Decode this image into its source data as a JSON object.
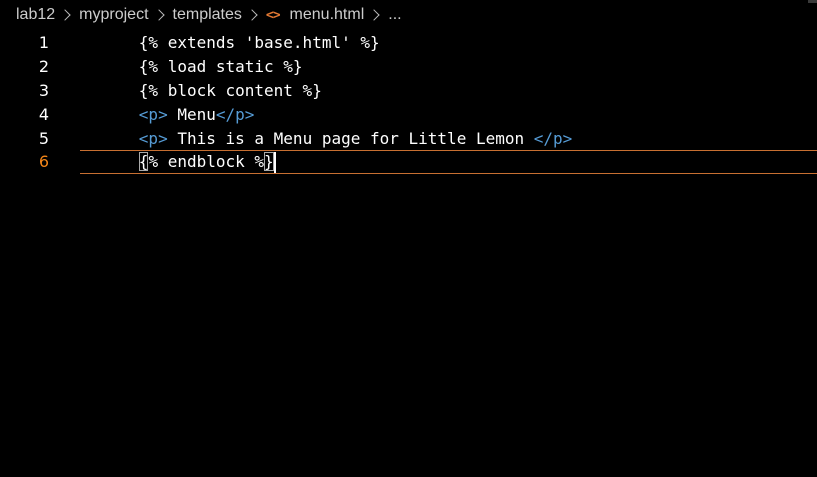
{
  "breadcrumb": {
    "items": [
      "lab12",
      "myproject",
      "templates",
      "menu.html",
      "..."
    ],
    "file_icon": "<>"
  },
  "editor": {
    "current_line": 6,
    "lines": [
      {
        "num": "1",
        "segments": [
          {
            "t": "{% extends 'base.html' %}",
            "c": "txt"
          }
        ]
      },
      {
        "num": "2",
        "segments": [
          {
            "t": "{% load static %}",
            "c": "txt"
          }
        ]
      },
      {
        "num": "3",
        "segments": [
          {
            "t": "{% block content %}",
            "c": "txt"
          }
        ]
      },
      {
        "num": "4",
        "segments": [
          {
            "t": "<p>",
            "c": "tag"
          },
          {
            "t": " Menu",
            "c": "txt"
          },
          {
            "t": "</p>",
            "c": "tag"
          }
        ]
      },
      {
        "num": "5",
        "segments": [
          {
            "t": "<p>",
            "c": "tag"
          },
          {
            "t": " This is a Menu page for Little Lemon ",
            "c": "txt"
          },
          {
            "t": "</p>",
            "c": "tag"
          }
        ]
      },
      {
        "num": "6",
        "segments": [
          {
            "t": "{",
            "c": "txt"
          },
          {
            "t": "% endblock %",
            "c": "txt"
          },
          {
            "t": "}",
            "c": "txt"
          }
        ]
      }
    ]
  },
  "colors": {
    "background": "#000000",
    "tag": "#569cd6",
    "text": "#ffffff",
    "active_line_number": "#f38518",
    "current_line_border": "#c76f31"
  }
}
